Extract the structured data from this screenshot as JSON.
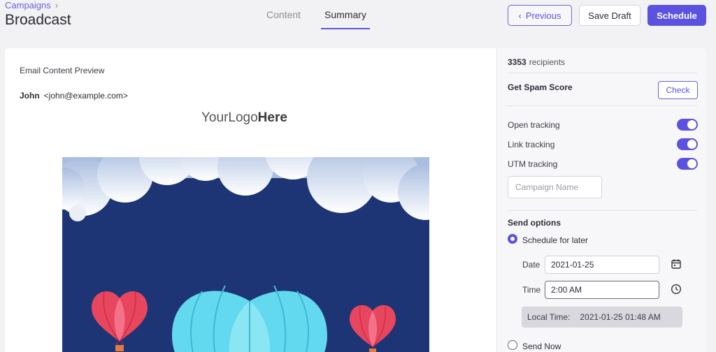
{
  "header": {
    "breadcrumb": "Campaigns",
    "title": "Broadcast",
    "tabs": [
      {
        "label": "Content",
        "active": false
      },
      {
        "label": "Summary",
        "active": true
      }
    ],
    "buttons": {
      "previous": "Previous",
      "save_draft": "Save Draft",
      "schedule": "Schedule"
    }
  },
  "preview": {
    "label": "Email Content Preview",
    "sender_name": "John",
    "sender_email": "<john@example.com>",
    "logo_regular": "YourLogo",
    "logo_bold": "Here"
  },
  "sidebar": {
    "recipients_count": "3353",
    "recipients_label": "recipients",
    "spam_label": "Get Spam Score",
    "check_label": "Check",
    "tracking": [
      {
        "label": "Open tracking",
        "enabled": true
      },
      {
        "label": "Link tracking",
        "enabled": true
      },
      {
        "label": "UTM tracking",
        "enabled": true
      }
    ],
    "campaign_placeholder": "Campaign Name",
    "send_options_label": "Send options",
    "schedule_later_label": "Schedule for later",
    "date_label": "Date",
    "date_value": "2021-01-25",
    "time_label": "Time",
    "time_value": "2:00 AM",
    "local_time_label": "Local Time:",
    "local_time_value": "2021-01-25 01:48 AM",
    "send_now_label": "Send Now"
  },
  "colors": {
    "accent": "#5b52e0",
    "sky": "#1e3575",
    "balloon_red": "#e8455e",
    "balloon_cyan": "#62d9ee"
  }
}
